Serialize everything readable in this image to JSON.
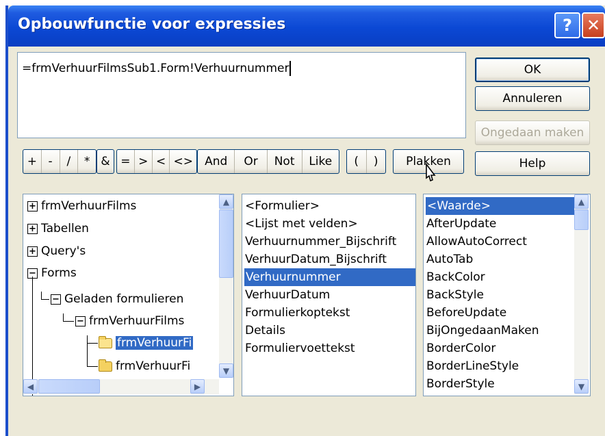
{
  "title": "Opbouwfunctie voor expressies",
  "expression": "=frmVerhuurFilmsSub1.Form!Verhuurnummer",
  "buttons": {
    "ok": "OK",
    "cancel": "Annuleren",
    "undo": "Ongedaan maken",
    "help": "Help",
    "paste": "Plakken"
  },
  "operators": {
    "arith": [
      "+",
      "-",
      "/",
      "*"
    ],
    "concat": [
      "&"
    ],
    "compare": [
      "=",
      ">",
      "<",
      "<>"
    ],
    "logic": [
      "And",
      "Or",
      "Not",
      "Like"
    ],
    "parens": [
      "(",
      ")"
    ]
  },
  "tree": [
    {
      "label": "frmVerhuurFilms",
      "state": "collapsed"
    },
    {
      "label": "Tabellen",
      "state": "collapsed"
    },
    {
      "label": "Query's",
      "state": "collapsed"
    },
    {
      "label": "Forms",
      "state": "expanded"
    },
    {
      "label": "Geladen formulieren",
      "state": "expanded"
    },
    {
      "label": "frmVerhuurFilms",
      "state": "expanded"
    },
    {
      "label": "frmVerhuurFi",
      "state": "selected"
    },
    {
      "label": "frmVerhuurFi",
      "state": "closed"
    }
  ],
  "middle_list": [
    "<Formulier>",
    "<Lijst met velden>",
    "Verhuurnummer_Bijschrift",
    "VerhuurDatum_Bijschrift",
    "Verhuurnummer",
    "VerhuurDatum",
    "Formulierkoptekst",
    "Details",
    "Formuliervoettekst"
  ],
  "middle_selected": "Verhuurnummer",
  "right_list": [
    "<Waarde>",
    "AfterUpdate",
    "AllowAutoCorrect",
    "AutoTab",
    "BackColor",
    "BackStyle",
    "BeforeUpdate",
    "BijOngedaanMaken",
    "BorderColor",
    "BorderLineStyle",
    "BorderStyle"
  ],
  "right_selected": "<Waarde>",
  "colors": {
    "titlebar": "#0B48D4",
    "selection": "#316AC5",
    "dialog": "#ECE9D8"
  }
}
